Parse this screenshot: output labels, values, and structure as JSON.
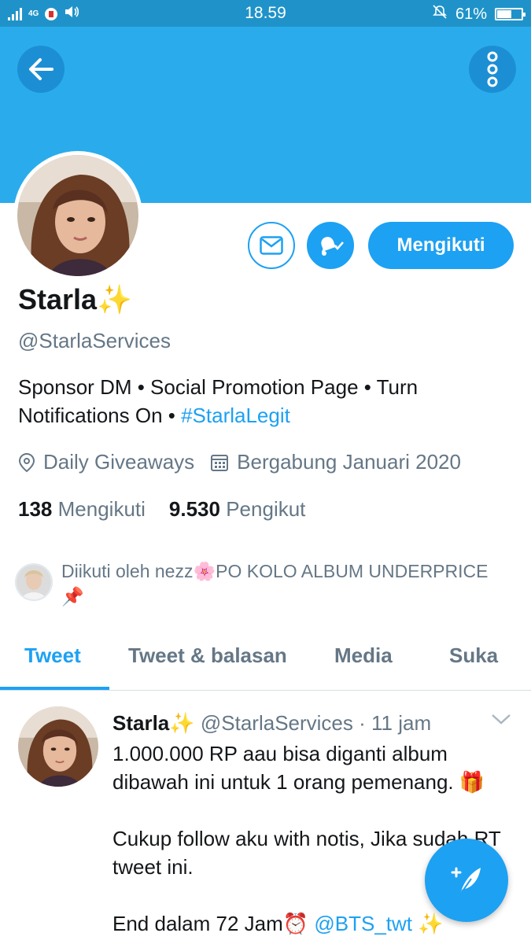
{
  "status_bar": {
    "network": "4G",
    "time": "18.59",
    "battery_percent": "61%",
    "battery_level": 0.61
  },
  "header": {
    "back_icon": "back-arrow-icon",
    "more_icon": "more-vertical-icon",
    "banner_color": "#2aacec"
  },
  "profile": {
    "name": "Starla",
    "name_emoji": "✨",
    "handle": "@StarlaServices",
    "bio_text": "Sponsor DM • Social Promotion Page • Turn Notifications On • ",
    "bio_hashtag": "#StarlaLegit",
    "location": "Daily Giveaways",
    "joined": "Bergabung Januari 2020",
    "following_count": "138",
    "following_label": "Mengikuti",
    "followers_count": "9.530",
    "followers_label": "Pengikut",
    "followed_by": "Diikuti oleh nezz🌸PO KOLO ALBUM UNDERPRICE 📌",
    "follow_button": "Mengikuti",
    "accent_color": "#1da1f2"
  },
  "tabs": [
    {
      "label": "Tweet",
      "active": true
    },
    {
      "label": "Tweet & balasan",
      "active": false
    },
    {
      "label": "Media",
      "active": false
    },
    {
      "label": "Suka",
      "active": false
    }
  ],
  "tweet": {
    "name": "Starla",
    "name_emoji": "✨",
    "handle": "@StarlaServices",
    "time": "· 11 jam",
    "line1": "1.000.000 RP aau bisa diganti album dibawah ini untuk 1 orang pemenang. 🎁",
    "line2": "Cukup follow aku with notis, Jika sudah RT tweet ini.",
    "line3_prefix": "End dalam 72 Jam⏰ ",
    "line3_mention": "@BTS_twt",
    "line3_suffix": " ✨"
  }
}
